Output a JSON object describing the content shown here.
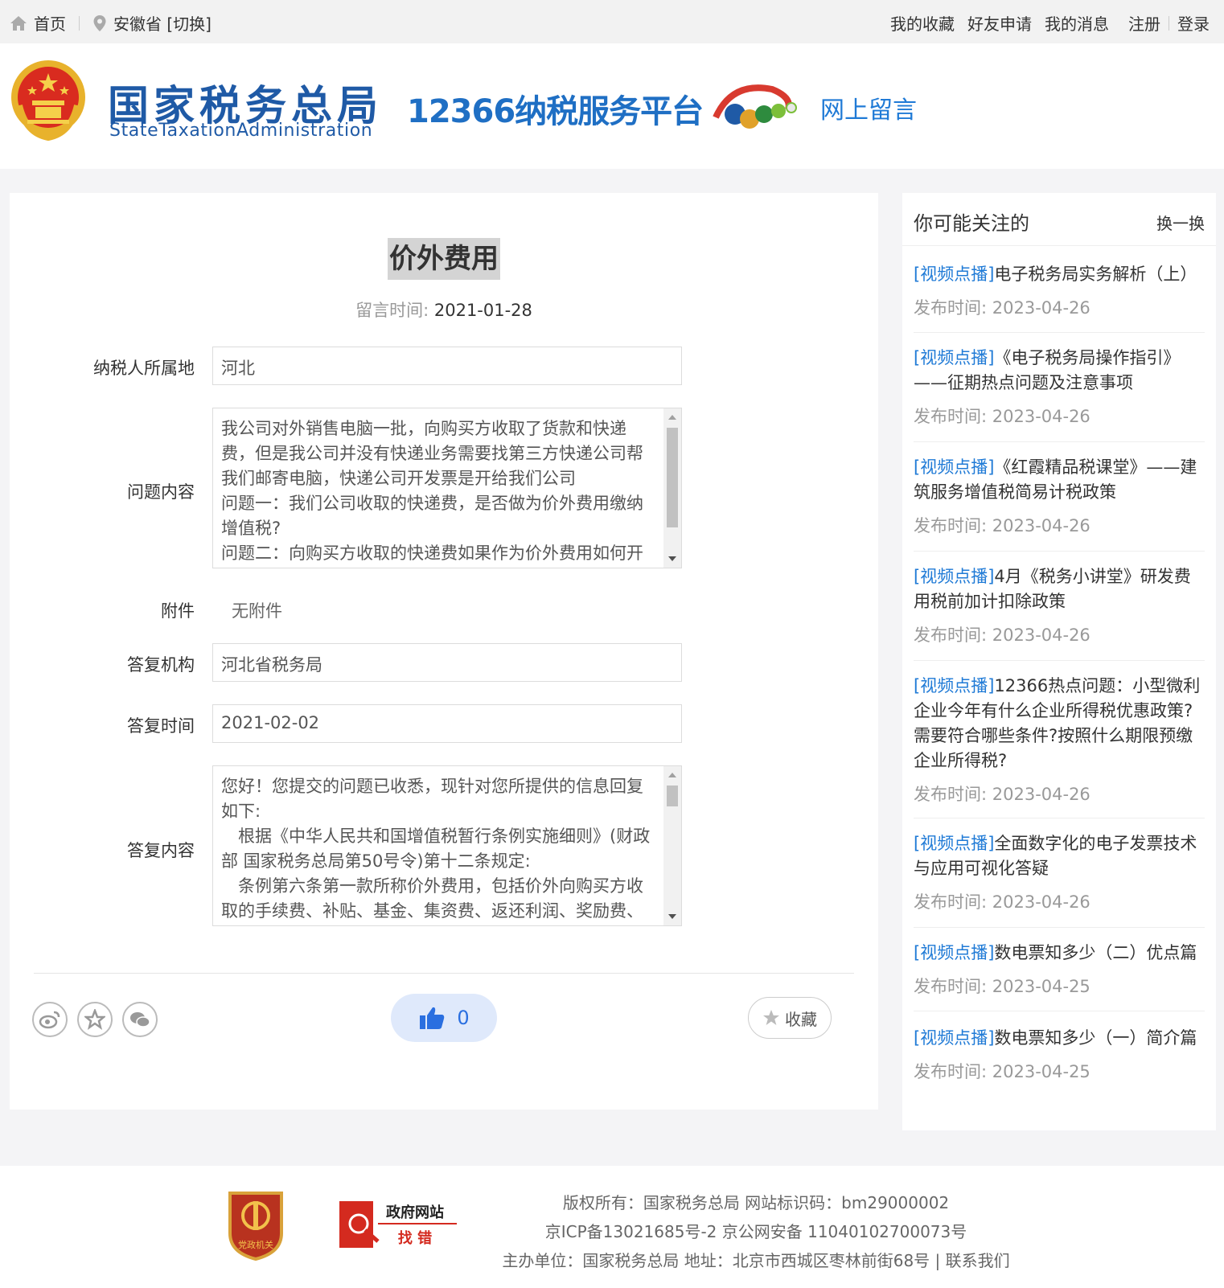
{
  "topbar": {
    "home": "首页",
    "location": "安徽省 [切换]",
    "links": [
      "我的收藏",
      "好友申请",
      "我的消息",
      "注册",
      "登录"
    ]
  },
  "header": {
    "logo_cn": "国家税务总局",
    "logo_en": "StateTaxationAdministration",
    "platform": "12366纳税服务平台",
    "section": "网上留言"
  },
  "article": {
    "title": "价外费用",
    "time_label": "留言时间:",
    "time_value": "2021-01-28",
    "location_label": "纳税人所属地",
    "location_value": "河北",
    "question_label": "问题内容",
    "question_lines": [
      "我公司对外销售电脑一批，向购买方收取了货款和快递",
      "费，但是我公司并没有快递业务需要找第三方快递公司帮",
      "我们邮寄电脑，快递公司开发票是开给我们公司",
      "问题一：我们公司收取的快递费，是否做为价外费用缴纳",
      "增值税?",
      "问题二：向购买方收取的快递费如果作为价外费用如何开"
    ],
    "attach_label": "附件",
    "attach_value": "无附件",
    "org_label": "答复机构",
    "org_value": "河北省税务局",
    "reply_time_label": "答复时间",
    "reply_time_value": "2021-02-02",
    "reply_label": "答复内容",
    "reply_lines": [
      "您好！您提交的问题已收悉，现针对您所提供的信息回复",
      "如下:",
      "　根据《中华人民共和国增值税暂行条例实施细则》(财政",
      "部 国家税务总局第50号令)第十二条规定:",
      "　条例第六条第一款所称价外费用，包括价外向购买方收",
      "取的手续费、补贴、基金、集资费、返还利润、奖励费、"
    ],
    "likes": "0",
    "fav_label": "收藏"
  },
  "sidebar": {
    "title": "你可能关注的",
    "refresh": "换一换",
    "items": [
      {
        "tag": "[视频点播]",
        "text": "电子税务局实务解析（上）",
        "date": "发布时间:  2023-04-26"
      },
      {
        "tag": "[视频点播]",
        "text": "《电子税务局操作指引》——征期热点问题及注意事项",
        "date": "发布时间:  2023-04-26"
      },
      {
        "tag": "[视频点播]",
        "text": "《红霞精品税课堂》——建筑服务增值税简易计税政策",
        "date": "发布时间:  2023-04-26"
      },
      {
        "tag": "[视频点播]",
        "text": "4月《税务小讲堂》研发费用税前加计扣除政策",
        "date": "发布时间:  2023-04-26"
      },
      {
        "tag": "[视频点播]",
        "text": "12366热点问题：小型微利企业今年有什么企业所得税优惠政策?需要符合哪些条件?按照什么期限预缴企业所得税?",
        "date": "发布时间:  2023-04-26"
      },
      {
        "tag": "[视频点播]",
        "text": "全面数字化的电子发票技术与应用可视化答疑",
        "date": "发布时间:  2023-04-26"
      },
      {
        "tag": "[视频点播]",
        "text": "数电票知多少（二）优点篇",
        "date": "发布时间:  2023-04-25"
      },
      {
        "tag": "[视频点播]",
        "text": "数电票知多少（一）简介篇",
        "date": "发布时间:  2023-04-25"
      }
    ]
  },
  "footer": {
    "line1": "版权所有：国家税务总局 网站标识码：bm29000002",
    "line2": "京ICP备13021685号-2 京公网安备 11040102700073号",
    "line3": "主办单位：国家税务总局 地址：北京市西城区枣林前街68号 | 联系我们",
    "gov_logo_top": "政府网站",
    "gov_logo_bottom": "找 错",
    "party_text": "党政机关"
  }
}
